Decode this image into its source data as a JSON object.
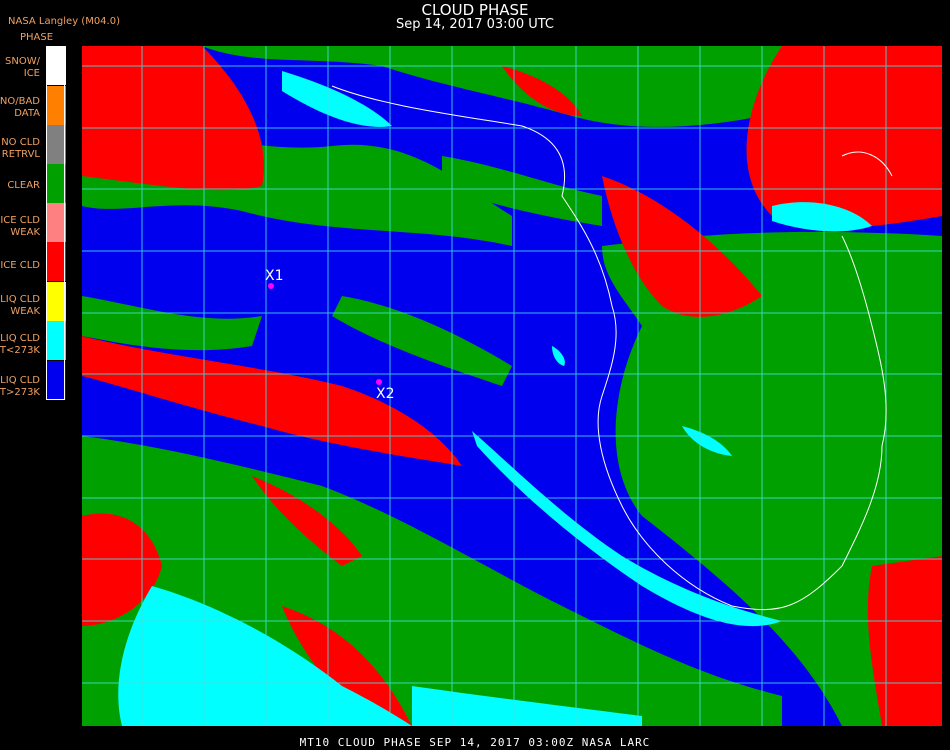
{
  "header": {
    "title": "CLOUD PHASE",
    "subtitle": "Sep 14, 2017 03:00 UTC",
    "source": "NASA Langley (M04.0)",
    "legend_title": "PHASE"
  },
  "legend": [
    {
      "label": "SNOW/\nICE",
      "color": "#ffffff"
    },
    {
      "label": "NO/BAD\nDATA",
      "color": "#ff8000"
    },
    {
      "label": "NO CLD\nRETRVL",
      "color": "#808080"
    },
    {
      "label": "CLEAR",
      "color": "#00a000"
    },
    {
      "label": "ICE CLD\nWEAK",
      "color": "#ff8080"
    },
    {
      "label": "ICE CLD",
      "color": "#ff0000"
    },
    {
      "label": "LIQ CLD\nWEAK",
      "color": "#ffff00"
    },
    {
      "label": "LIQ CLD\nT<273K",
      "color": "#00ffff"
    },
    {
      "label": "LIQ CLD\nT>273K",
      "color": "#0000ee"
    }
  ],
  "markers": [
    {
      "label": "X1"
    },
    {
      "label": "X2"
    }
  ],
  "footer": "MT10  CLOUD PHASE   SEP 14, 2017 03:00Z  NASA LARC"
}
